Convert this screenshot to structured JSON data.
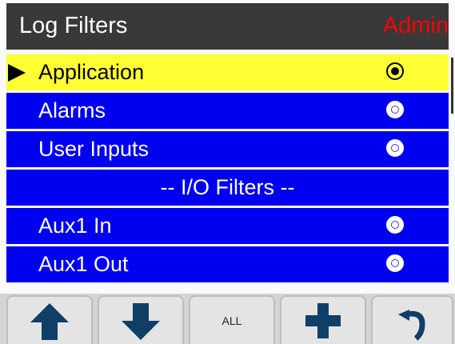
{
  "header": {
    "title": "Log Filters",
    "user_role": "Admin"
  },
  "colors": {
    "row_bg": "#0000f0",
    "selected_bg": "#ffff33",
    "header_bg": "#383838",
    "role_text": "#ff0000"
  },
  "list": {
    "items": [
      {
        "label": "Application",
        "selected": true,
        "has_radio": true
      },
      {
        "label": "Alarms",
        "selected": false,
        "has_radio": true
      },
      {
        "label": "User Inputs",
        "selected": false,
        "has_radio": true
      },
      {
        "label": "-- I/O Filters --",
        "selected": false,
        "has_radio": false
      },
      {
        "label": "Aux1 In",
        "selected": false,
        "has_radio": true
      },
      {
        "label": "Aux1 Out",
        "selected": false,
        "has_radio": true
      }
    ]
  },
  "toolbar": {
    "buttons": [
      {
        "name": "up",
        "icon": "arrow-up-icon"
      },
      {
        "name": "down",
        "icon": "arrow-down-icon"
      },
      {
        "name": "all",
        "label": "ALL"
      },
      {
        "name": "add",
        "icon": "plus-icon"
      },
      {
        "name": "back",
        "icon": "return-arrow-icon"
      }
    ]
  }
}
